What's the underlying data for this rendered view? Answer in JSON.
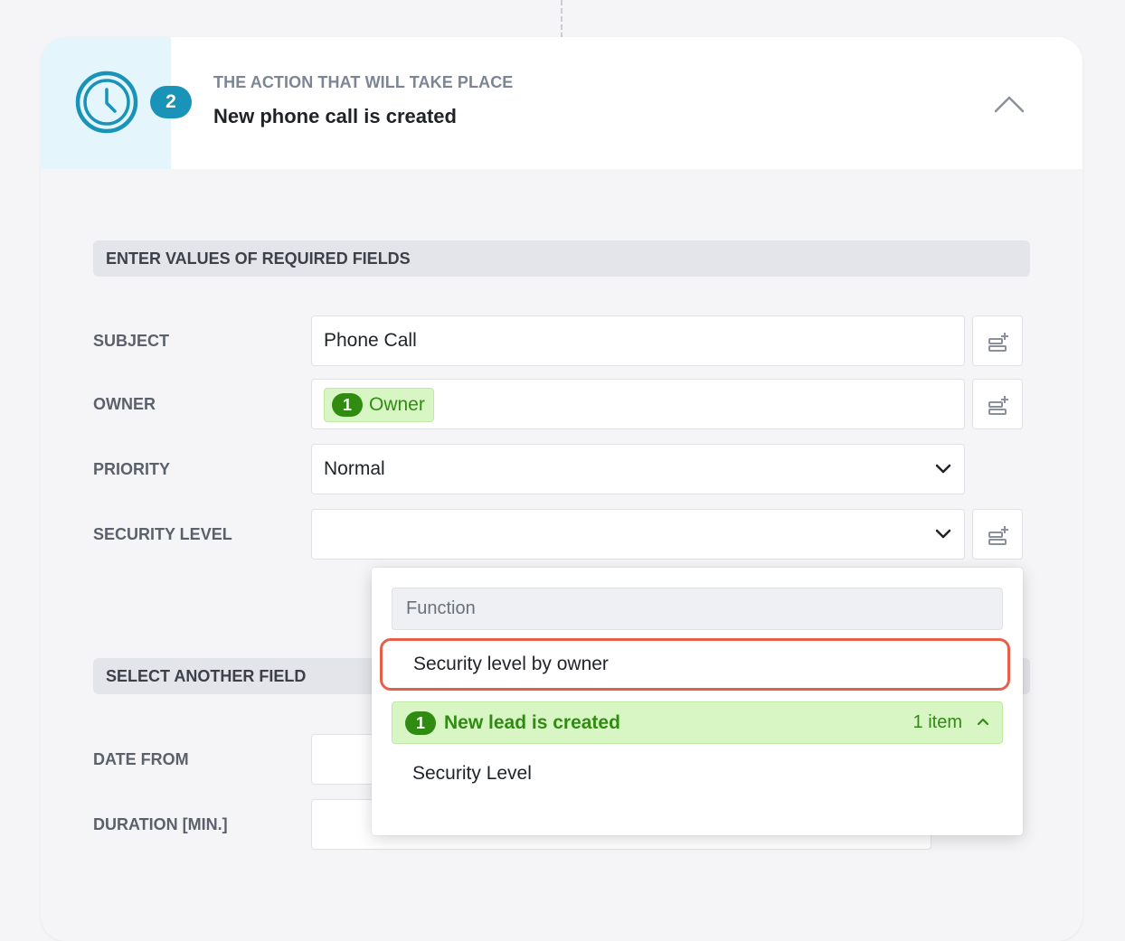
{
  "header": {
    "step_number": "2",
    "caption": "THE ACTION THAT WILL TAKE PLACE",
    "title": "New phone call is created",
    "icon": "clock-icon",
    "accent_color": "#1a93b8"
  },
  "required_section": {
    "title": "ENTER VALUES OF REQUIRED FIELDS",
    "fields": {
      "subject": {
        "label": "SUBJECT",
        "value": "Phone Call"
      },
      "owner": {
        "label": "OWNER",
        "tag_number": "1",
        "tag_label": "Owner"
      },
      "priority": {
        "label": "PRIORITY",
        "value": "Normal"
      },
      "security_level": {
        "label": "SECURITY LEVEL",
        "value": ""
      }
    }
  },
  "other_section": {
    "title": "SELECT ANOTHER FIELD",
    "fields": {
      "date_from": {
        "label": "DATE FROM"
      },
      "duration": {
        "label": "DURATION [MIN.]"
      }
    }
  },
  "dropdown": {
    "group_label": "Function",
    "highlighted_option": "Security level by owner",
    "source": {
      "number": "1",
      "title": "New lead is created",
      "count": "1 item"
    },
    "option": "Security Level",
    "highlight_color": "#e4604a",
    "success_color": "#2f8c11"
  }
}
